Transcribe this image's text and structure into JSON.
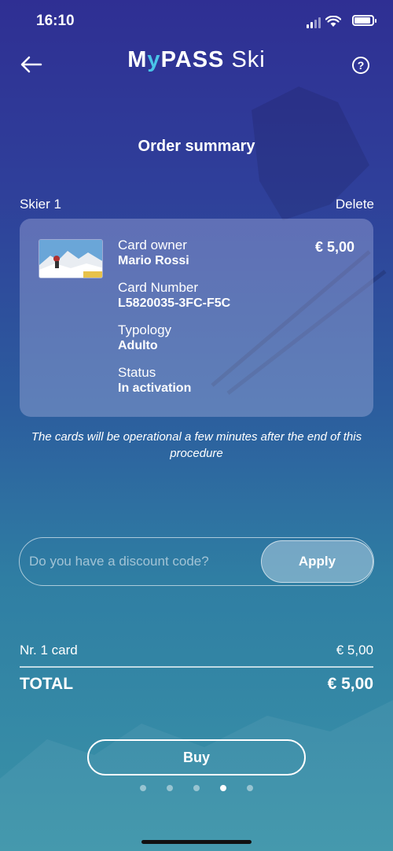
{
  "status_bar": {
    "time": "16:10"
  },
  "header": {
    "logo_parts": [
      "M",
      "y",
      "PASS",
      "Ski"
    ],
    "title": "Order summary"
  },
  "skier": {
    "label": "Skier 1",
    "delete_label": "Delete"
  },
  "card": {
    "price": "€ 5,00",
    "fields": [
      {
        "label": "Card owner",
        "value": "Mario Rossi"
      },
      {
        "label": "Card Number",
        "value": "L5820035-3FC-F5C"
      },
      {
        "label": "Typology",
        "value": "Adulto"
      },
      {
        "label": "Status",
        "value": "In activation"
      }
    ]
  },
  "note": "The cards will be operational a few minutes after the end of this procedure",
  "discount": {
    "placeholder": "Do you have a discount code?",
    "apply_label": "Apply"
  },
  "summary": {
    "line_label": "Nr. 1 card",
    "line_value": "€ 5,00",
    "total_label": "TOTAL",
    "total_value": "€ 5,00"
  },
  "buy_label": "Buy",
  "pagination": {
    "total": 5,
    "active_index": 3
  },
  "colors": {
    "accent": "#49c4e8",
    "bg_top": "#2f2f93",
    "bg_bottom": "#3a93a8"
  }
}
